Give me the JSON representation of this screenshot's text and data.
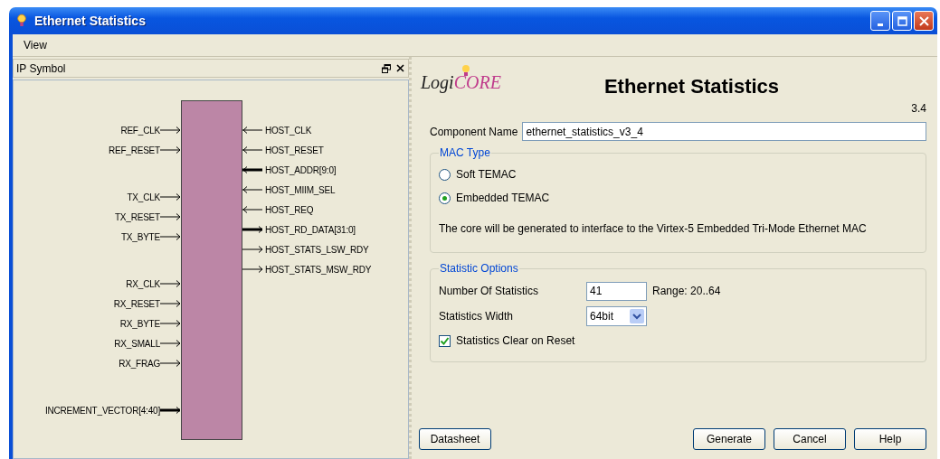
{
  "window": {
    "title": "Ethernet Statistics"
  },
  "menu": [
    {
      "label": "View"
    }
  ],
  "ip_symbol": {
    "title": "IP Symbol",
    "left_pin_groups": [
      [
        {
          "name": "REF_CLK",
          "output": false,
          "bus": false
        },
        {
          "name": "REF_RESET",
          "output": false,
          "bus": false
        }
      ],
      [
        {
          "name": "TX_CLK",
          "output": false,
          "bus": false
        },
        {
          "name": "TX_RESET",
          "output": false,
          "bus": false
        },
        {
          "name": "TX_BYTE",
          "output": false,
          "bus": false
        }
      ],
      [
        {
          "name": "RX_CLK",
          "output": false,
          "bus": false
        },
        {
          "name": "RX_RESET",
          "output": false,
          "bus": false
        },
        {
          "name": "RX_BYTE",
          "output": false,
          "bus": false
        },
        {
          "name": "RX_SMALL",
          "output": false,
          "bus": false
        },
        {
          "name": "RX_FRAG",
          "output": false,
          "bus": false
        }
      ],
      [
        {
          "name": "INCREMENT_VECTOR[4:40]",
          "output": false,
          "bus": true
        }
      ]
    ],
    "right_pins": [
      {
        "name": "HOST_CLK",
        "output": false,
        "bus": false
      },
      {
        "name": "HOST_RESET",
        "output": false,
        "bus": false
      },
      {
        "name": "HOST_ADDR[9:0]",
        "output": false,
        "bus": true
      },
      {
        "name": "HOST_MIIM_SEL",
        "output": false,
        "bus": false
      },
      {
        "name": "HOST_REQ",
        "output": false,
        "bus": false
      },
      {
        "name": "HOST_RD_DATA[31:0]",
        "output": true,
        "bus": true
      },
      {
        "name": "HOST_STATS_LSW_RDY",
        "output": true,
        "bus": false
      },
      {
        "name": "HOST_STATS_MSW_RDY",
        "output": true,
        "bus": false
      }
    ]
  },
  "header": {
    "logo_prefix": "Logi",
    "logo_suffix": "CORE",
    "title": "Ethernet Statistics",
    "version": "3.4"
  },
  "component_name": {
    "label": "Component Name",
    "value": "ethernet_statistics_v3_4"
  },
  "mac_type": {
    "title": "MAC Type",
    "options": [
      {
        "label": "Soft TEMAC",
        "selected": false
      },
      {
        "label": "Embedded TEMAC",
        "selected": true
      }
    ],
    "description": "The core will be generated to interface to the Virtex-5 Embedded Tri-Mode Ethernet MAC"
  },
  "statistic_options": {
    "title": "Statistic Options",
    "number": {
      "label": "Number Of Statistics",
      "value": "41",
      "range": "Range: 20..64"
    },
    "width": {
      "label": "Statistics Width",
      "value": "64bit"
    },
    "clear_on_reset": {
      "label": "Statistics Clear on Reset",
      "checked": true
    }
  },
  "buttons_left": [
    "Datasheet"
  ],
  "buttons_right": [
    "Generate",
    "Cancel",
    "Help"
  ]
}
